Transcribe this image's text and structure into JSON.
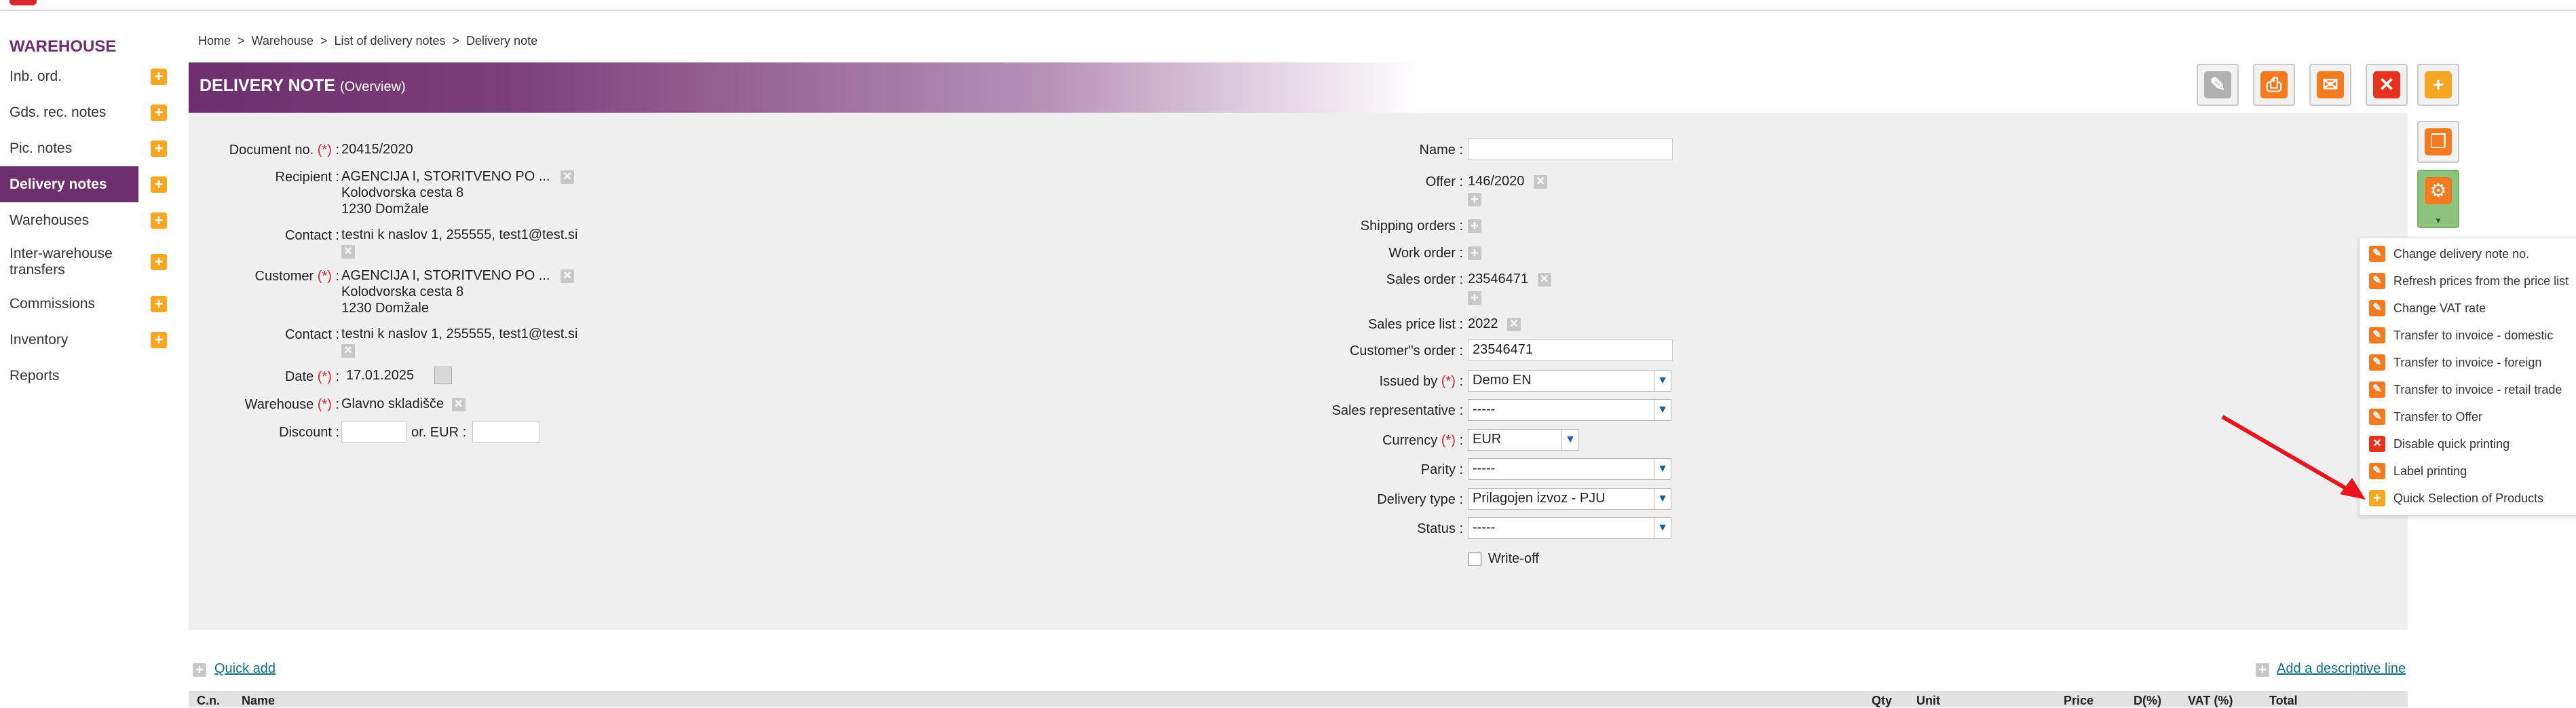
{
  "sidebar": {
    "title": "WAREHOUSE",
    "items": [
      {
        "label": "Inb. ord."
      },
      {
        "label": "Gds. rec. notes"
      },
      {
        "label": "Pic. notes"
      },
      {
        "label": "Delivery notes"
      },
      {
        "label": "Warehouses"
      },
      {
        "label": "Inter-warehouse transfers"
      },
      {
        "label": "Commissions"
      },
      {
        "label": "Inventory"
      },
      {
        "label": "Reports"
      }
    ]
  },
  "breadcrumb": [
    "Home",
    "Warehouse",
    "List of delivery notes",
    "Delivery note"
  ],
  "breadcrumb_sep": ">",
  "header": {
    "title": "DELIVERY NOTE",
    "subtitle": "(Overview)"
  },
  "left": {
    "document_no_label": "Document no.",
    "document_no": "20415/2020",
    "recipient_label": "Recipient :",
    "recipient_name": "AGENCIJA I, STORITVENO PO ...",
    "recipient_street": "Kolodvorska cesta 8",
    "recipient_city": "1230 Domžale",
    "contact_label": "Contact :",
    "contact1": "testni k naslov 1, 255555, test1@test.si",
    "customer_label": "Customer",
    "customer_name": "AGENCIJA I, STORITVENO PO ...",
    "customer_street": "Kolodvorska cesta 8",
    "customer_city": "1230 Domžale",
    "contact2": "testni k naslov 1, 255555, test1@test.si",
    "date_label": "Date",
    "date_value": "17.01.2025",
    "warehouse_label": "Warehouse",
    "warehouse_value": "Glavno skladišče",
    "discount_label": "Discount :",
    "or_eur_label": "or. EUR :",
    "required_mark": "(*)",
    "colon": ":"
  },
  "right": {
    "name_label": "Name :",
    "offer_label": "Offer :",
    "offer_value": "146/2020",
    "shipping_label": "Shipping orders :",
    "work_order_label": "Work order :",
    "sales_order_label": "Sales order :",
    "sales_order_value": "23546471",
    "price_list_label": "Sales price list :",
    "price_list_value": "2022",
    "customers_order_label": "Customer\"s order :",
    "customers_order_value": "23546471",
    "issued_by_label": "Issued by",
    "issued_by_value": "Demo EN",
    "sales_rep_label": "Sales representative :",
    "sales_rep_value": "-----",
    "currency_label": "Currency",
    "currency_value": "EUR",
    "parity_label": "Parity :",
    "parity_value": "-----",
    "delivery_type_label": "Delivery type :",
    "delivery_type_value": "Prilagojen izvoz - PJU",
    "status_label": "Status :",
    "status_value": "-----",
    "write_off_label": "Write-off"
  },
  "dropdown_menu": [
    {
      "label": "Change delivery note no.",
      "icon": "pencil-icon"
    },
    {
      "label": "Refresh prices from the price list",
      "icon": "pencil-icon"
    },
    {
      "label": "Change VAT rate",
      "icon": "pencil-icon"
    },
    {
      "label": "Transfer to invoice - domestic",
      "icon": "pencil-icon"
    },
    {
      "label": "Transfer to invoice - foreign",
      "icon": "pencil-icon"
    },
    {
      "label": "Transfer to invoice - retail trade",
      "icon": "pencil-icon"
    },
    {
      "label": "Transfer to Offer",
      "icon": "pencil-icon"
    },
    {
      "label": "Disable quick printing",
      "icon": "close-icon"
    },
    {
      "label": "Label printing",
      "icon": "pencil-icon"
    },
    {
      "label": "Quick Selection of Products",
      "icon": "plus-icon"
    }
  ],
  "bottom": {
    "quick_add": "Quick add",
    "add_descriptive_line": "Add a descriptive line"
  },
  "table_headers": [
    "C.n.",
    "Name",
    "Qty",
    "Unit",
    "Price",
    "D(%)",
    "VAT (%)",
    "Total"
  ],
  "colors": {
    "brand": "#6d2f6d",
    "accent_orange": "#f47a20",
    "danger": "#d9272e",
    "arrow": "#e8141e"
  }
}
